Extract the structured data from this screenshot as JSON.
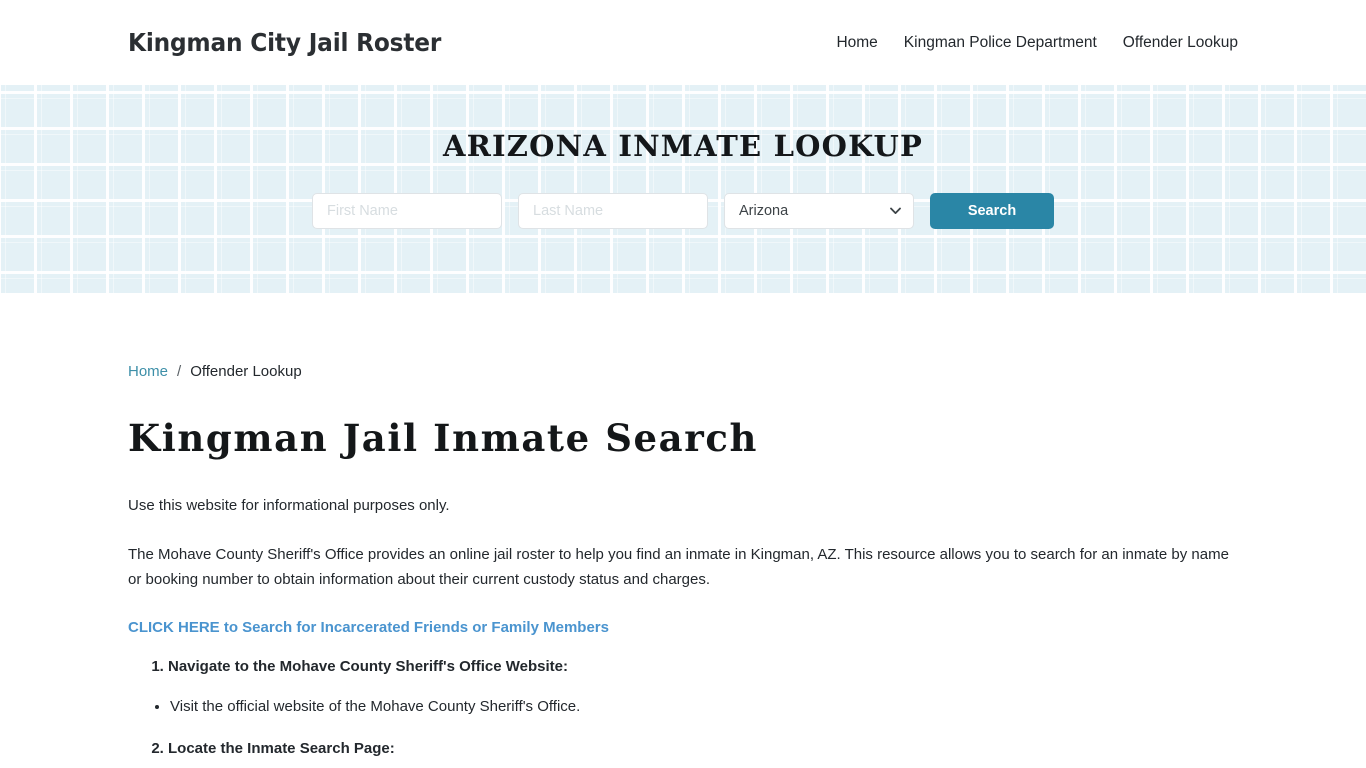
{
  "header": {
    "site_title": "Kingman City Jail Roster",
    "nav": [
      {
        "label": "Home"
      },
      {
        "label": "Kingman Police Department"
      },
      {
        "label": "Offender Lookup"
      }
    ]
  },
  "hero": {
    "title": "ARIZONA INMATE LOOKUP",
    "background_color": "#e4f1f6",
    "search": {
      "first_name_placeholder": "First Name",
      "first_name_value": "",
      "last_name_placeholder": "Last Name",
      "last_name_value": "",
      "state_selected": "Arizona",
      "state_options": [
        "Arizona"
      ],
      "submit_label": "Search",
      "submit_color": "#2a86a6",
      "chevron_icon": "chevron-down-icon"
    }
  },
  "breadcrumb": {
    "home_label": "Home",
    "separator": "/",
    "current_label": "Offender Lookup",
    "link_color": "#3d8fa8"
  },
  "main": {
    "page_title": "Kingman Jail Inmate Search",
    "intro": "Use this website for informational purposes only.",
    "description": "The Mohave County Sheriff's Office provides an online jail roster to help you find an inmate in Kingman, AZ. This resource allows you to search for an inmate by name or booking number to obtain information about their current custody status and charges.",
    "cta_label": "CLICK HERE to Search for Incarcerated Friends or Family Members",
    "cta_color": "#4a94cf",
    "steps": [
      {
        "label": "Navigate to the Mohave County Sheriff's Office Website:"
      },
      {
        "label": "Locate the Inmate Search Page:"
      }
    ],
    "substeps": [
      {
        "label": "Visit the official website of the Mohave County Sheriff's Office."
      }
    ]
  }
}
